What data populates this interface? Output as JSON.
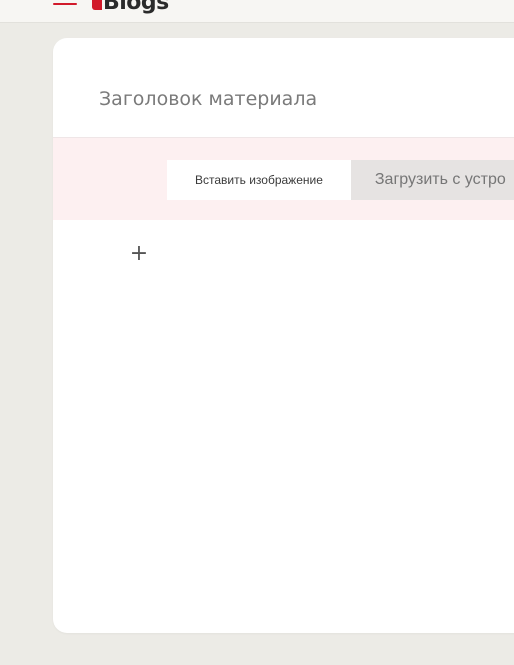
{
  "header": {
    "logo_text": "Blogs",
    "menu_icon": "hamburger-menu-icon",
    "accent_color": "#d11a2a"
  },
  "editor": {
    "title_placeholder": "Заголовок материала",
    "image_block": {
      "insert_tab_label": "Вставить изображение",
      "upload_tab_label": "Загрузить с устро"
    },
    "add_block_icon": "plus-icon",
    "add_block_glyph": "+"
  }
}
